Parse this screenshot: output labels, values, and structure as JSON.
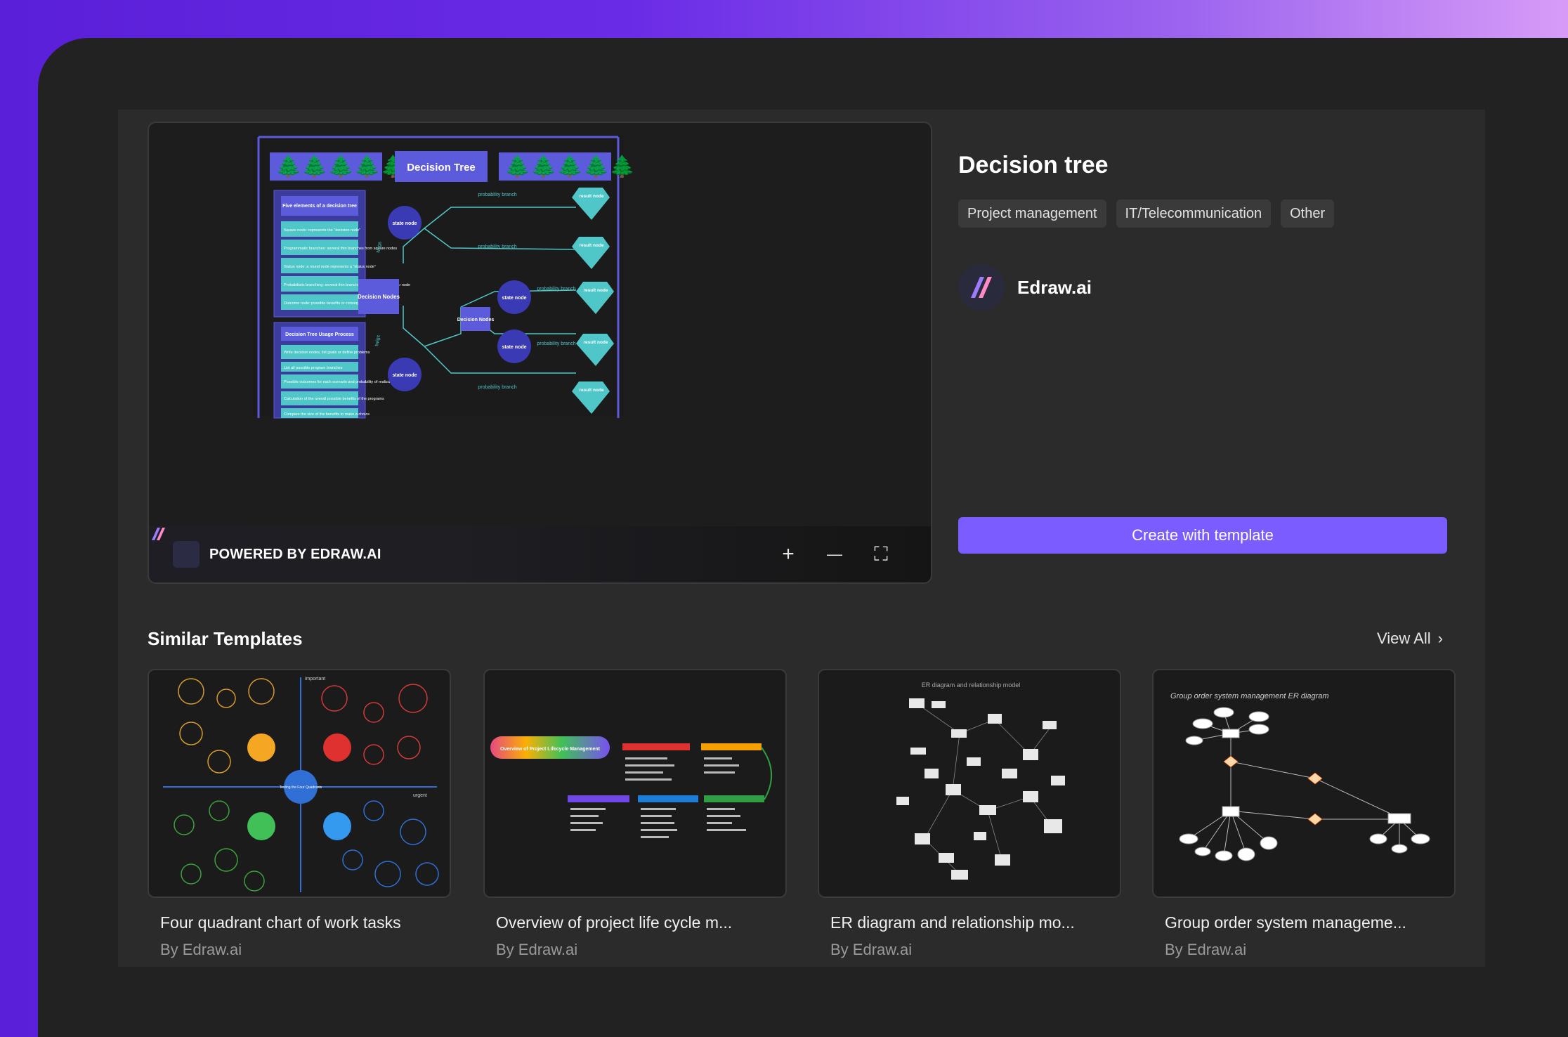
{
  "preview": {
    "diagram_title": "Decision Tree",
    "left_box1_title": "Five elements of a decision tree",
    "left_box1_items": [
      "Square node: represents the \"decision node\"",
      "Programmatic branches: several thin branches from square nodes",
      "Status node: a round node represents a \"status node\"",
      "Probabilistic branching: several thin branches leading from a circular node",
      "Outcome node: possible benefits or consequences"
    ],
    "left_box2_title": "Decision Tree Usage Process",
    "left_box2_items": [
      "Write decision nodes, list goals or define problems",
      "List all possible program branches",
      "Possible outcomes for each scenario and probability of realization",
      "Calculation of the overall possible benefits of the programs",
      "Compare the size of the benefits to make a choice"
    ],
    "decision_nodes": "Decision Nodes",
    "decision_nodes2": "Decision Nodes",
    "state_node": "state node",
    "state_node_short1": "state node",
    "state_node_short2": "state node",
    "state_node_bottom": "state node",
    "probability_branch": "probability branch",
    "result_node": "result node",
    "twigs": "twigs",
    "powered_by": "POWERED BY EDRAW.AI",
    "controls": {
      "zoom_in": "+",
      "zoom_out": "—",
      "fullscreen": "⛶"
    }
  },
  "template": {
    "title": "Decision tree",
    "tags": [
      "Project management",
      "IT/Telecommunication",
      "Other"
    ],
    "author": "Edraw.ai",
    "cta": "Create with template"
  },
  "similar": {
    "heading": "Similar Templates",
    "view_all": "View All",
    "cards": [
      {
        "title": "Four quadrant chart of work tasks",
        "author": "By Edraw.ai",
        "inner_texts": [
          "important",
          "urgent",
          "Testing the Four Quadrants"
        ]
      },
      {
        "title": "Overview of project life cycle m...",
        "author": "By Edraw.ai",
        "inner_texts": [
          "Overview of Project Lifecycle Management"
        ]
      },
      {
        "title": "ER diagram and relationship mo...",
        "author": "By Edraw.ai",
        "inner_texts": [
          "ER diagram and relationship model"
        ]
      },
      {
        "title": "Group order system manageme...",
        "author": "By Edraw.ai",
        "inner_texts": [
          "Group order system management ER diagram"
        ]
      }
    ]
  },
  "colors": {
    "accent": "#7a5cff",
    "diagram_blue": "#5b5bdc",
    "diagram_teal": "#4fc7c8",
    "panel": "#2b2b2b"
  }
}
